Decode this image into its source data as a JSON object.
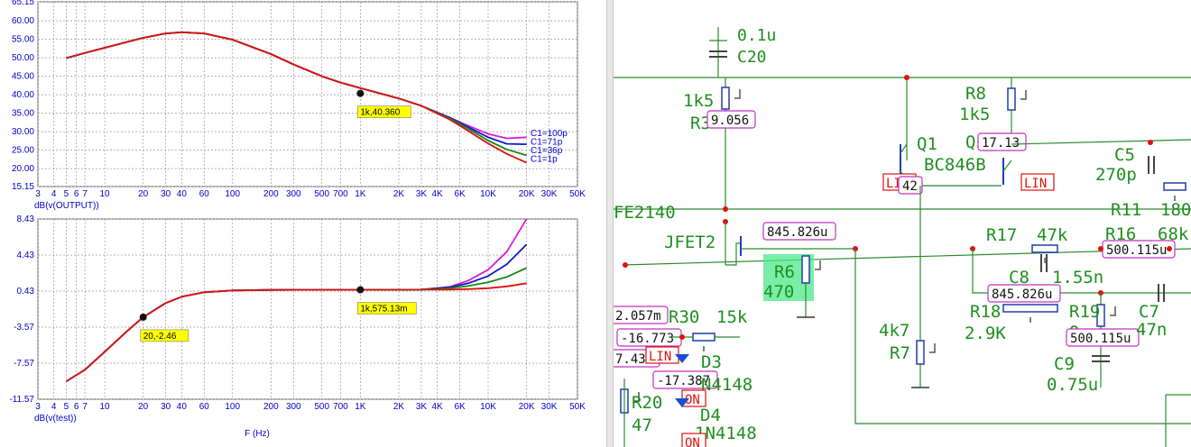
{
  "colors": {
    "axis_text": "#0000cc",
    "grid": "#9a9a9a",
    "series_c1_100p": "#d81ed8",
    "series_c1_71p": "#1414c8",
    "series_c1_36p": "#138a13",
    "series_c1_1p": "#dd1111",
    "cursor_label_bg": "#ffff00",
    "wire": "#2a8a2a",
    "part_text": "#1f8f1f",
    "component": "#1e3faa",
    "node": "#dd1111",
    "voltage_box_border": "#c030c0",
    "lin_tag": "#dd1111",
    "selection": "#4ce88a"
  },
  "chart_data": [
    {
      "type": "line",
      "xlabel": "",
      "ylabel": "dB(v(OUTPUT))",
      "xscale": "log",
      "xlim": [
        3,
        50000
      ],
      "ylim": [
        15.15,
        65.15
      ],
      "x_ticks": [
        3,
        4,
        5,
        6,
        7,
        10,
        20,
        30,
        40,
        60,
        100,
        200,
        300,
        500,
        700,
        1000,
        2000,
        3000,
        4000,
        6000,
        10000,
        20000,
        30000,
        50000
      ],
      "x_tick_labels": [
        "3",
        "4",
        "5",
        "6",
        "7",
        "10",
        "20",
        "30",
        "40",
        "60",
        "100",
        "200",
        "300",
        "500",
        "700",
        "1K",
        "2K",
        "3K",
        "4K",
        "6K",
        "10K",
        "20K",
        "30K",
        "50K"
      ],
      "y_ticks": [
        15.15,
        20.0,
        25.0,
        30.0,
        35.0,
        40.0,
        45.0,
        50.0,
        55.0,
        60.0,
        65.15
      ],
      "y_tick_labels": [
        "15.15",
        "20.00",
        "25.00",
        "30.00",
        "35.00",
        "40.00",
        "45.00",
        "50.00",
        "55.00",
        "60.00",
        "65.15"
      ],
      "grid": true,
      "legend": [
        "C1=100p",
        "C1=71p",
        "C1=36p",
        "C1=1p"
      ],
      "legend_placement": "right",
      "x": [
        5,
        7,
        10,
        15,
        20,
        30,
        40,
        60,
        100,
        200,
        300,
        500,
        700,
        1000,
        2000,
        3000,
        5000,
        7000,
        10000,
        14000,
        20000
      ],
      "series": [
        {
          "name": "C1=100p",
          "values": [
            49.9,
            51.3,
            52.7,
            54.3,
            55.4,
            56.6,
            56.9,
            56.6,
            54.9,
            51.0,
            48.2,
            45.0,
            43.3,
            41.8,
            39.0,
            37.0,
            33.8,
            31.6,
            29.4,
            28.2,
            28.5
          ]
        },
        {
          "name": "C1=71p",
          "values": [
            49.9,
            51.3,
            52.7,
            54.3,
            55.4,
            56.6,
            56.9,
            56.6,
            54.9,
            51.0,
            48.2,
            45.0,
            43.3,
            41.8,
            39.0,
            37.0,
            33.8,
            31.2,
            28.5,
            26.7,
            26.6
          ]
        },
        {
          "name": "C1=36p",
          "values": [
            49.9,
            51.3,
            52.7,
            54.3,
            55.4,
            56.6,
            56.9,
            56.6,
            54.9,
            51.0,
            48.2,
            45.0,
            43.3,
            41.8,
            39.0,
            37.0,
            33.6,
            30.8,
            27.6,
            25.2,
            23.6
          ]
        },
        {
          "name": "C1=1p",
          "values": [
            49.9,
            51.3,
            52.7,
            54.3,
            55.4,
            56.6,
            56.9,
            56.6,
            54.9,
            51.0,
            48.2,
            45.0,
            43.3,
            41.8,
            39.0,
            37.0,
            33.3,
            30.2,
            26.8,
            24.0,
            21.6
          ]
        }
      ],
      "cursors": [
        {
          "x": 1000,
          "y": 40.36,
          "label": "1k,40.360"
        }
      ]
    },
    {
      "type": "line",
      "xlabel": "F (Hz)",
      "ylabel": "dB(v(test))",
      "xscale": "log",
      "xlim": [
        3,
        50000
      ],
      "ylim": [
        -11.57,
        8.43
      ],
      "x_ticks": [
        3,
        4,
        5,
        6,
        7,
        10,
        20,
        30,
        40,
        60,
        100,
        200,
        300,
        500,
        700,
        1000,
        2000,
        3000,
        4000,
        6000,
        10000,
        20000,
        30000,
        50000
      ],
      "x_tick_labels": [
        "3",
        "4",
        "5",
        "6",
        "7",
        "10",
        "20",
        "30",
        "40",
        "60",
        "100",
        "200",
        "300",
        "500",
        "700",
        "1K",
        "2K",
        "3K",
        "4K",
        "6K",
        "10K",
        "20K",
        "30K",
        "50K"
      ],
      "y_ticks": [
        -11.57,
        -7.57,
        -3.57,
        0.43,
        4.43,
        8.43
      ],
      "y_tick_labels": [
        "-11.57",
        "-7.57",
        "-3.57",
        "0.43",
        "4.43",
        "8.43"
      ],
      "grid": true,
      "x": [
        5,
        7,
        10,
        15,
        20,
        30,
        40,
        60,
        100,
        200,
        300,
        500,
        700,
        1000,
        2000,
        3000,
        5000,
        7000,
        10000,
        14000,
        20000
      ],
      "series": [
        {
          "name": "C1=100p",
          "values": [
            -9.6,
            -8.3,
            -6.3,
            -4.0,
            -2.46,
            -0.9,
            -0.2,
            0.3,
            0.5,
            0.56,
            0.57,
            0.575,
            0.575,
            0.575,
            0.58,
            0.6,
            0.9,
            1.6,
            2.8,
            4.8,
            8.43
          ]
        },
        {
          "name": "C1=71p",
          "values": [
            -9.6,
            -8.3,
            -6.3,
            -4.0,
            -2.46,
            -0.9,
            -0.2,
            0.3,
            0.5,
            0.56,
            0.57,
            0.575,
            0.575,
            0.575,
            0.58,
            0.6,
            0.85,
            1.3,
            2.1,
            3.4,
            5.6
          ]
        },
        {
          "name": "C1=36p",
          "values": [
            -9.6,
            -8.3,
            -6.3,
            -4.0,
            -2.46,
            -0.9,
            -0.2,
            0.3,
            0.5,
            0.56,
            0.57,
            0.575,
            0.575,
            0.575,
            0.58,
            0.6,
            0.75,
            1.0,
            1.4,
            2.0,
            3.0
          ]
        },
        {
          "name": "C1=1p",
          "values": [
            -9.6,
            -8.3,
            -6.3,
            -4.0,
            -2.46,
            -0.9,
            -0.2,
            0.3,
            0.5,
            0.56,
            0.57,
            0.575,
            0.575,
            0.575,
            0.58,
            0.59,
            0.6,
            0.65,
            0.75,
            0.95,
            1.3
          ]
        }
      ],
      "cursors": [
        {
          "x": 20,
          "y": -2.46,
          "label": "20,-2.46"
        },
        {
          "x": 1000,
          "y": 0.575,
          "label": "1k,575.13m"
        }
      ]
    }
  ],
  "schematic": {
    "parts": {
      "c20": {
        "value": "0.1u",
        "ref": "C20"
      },
      "r3": {
        "value": "1k5",
        "ref": "R3"
      },
      "r8": {
        "ref": "R8",
        "value": "1k5"
      },
      "q1": {
        "ref": "Q1",
        "model": "BC846B"
      },
      "q2": {
        "ref": "Q"
      },
      "c5": {
        "ref": "C5",
        "value": "270p"
      },
      "jfet": {
        "model": "FE2140",
        "ref": "JFET2"
      },
      "r11": {
        "ref": "R11",
        "value": "180"
      },
      "r16": {
        "ref": "R16",
        "value": "68k"
      },
      "r17": {
        "ref": "R17",
        "value": "47k"
      },
      "r6": {
        "ref": "R6",
        "value": "470"
      },
      "c8": {
        "ref": "C8",
        "value": "1.55n"
      },
      "r18": {
        "ref": "R18",
        "value": "2.9K"
      },
      "r19": {
        "ref": "R19",
        "value": "9"
      },
      "c7": {
        "ref": "C7",
        "value": "47n"
      },
      "r7": {
        "value": "4k7",
        "ref": "R7"
      },
      "c9": {
        "ref": "C9",
        "value": "0.75u"
      },
      "r30": {
        "ref": "R30",
        "value": "15k"
      },
      "d3": {
        "ref": "D3",
        "model": "N4148"
      },
      "d4": {
        "ref": "D4",
        "model": "1N4148"
      },
      "r20": {
        "ref": "R20",
        "value": "47"
      }
    },
    "readouts": {
      "r3_v": "9.056",
      "q2_v": "17.13",
      "q1_v": "42",
      "jfet_v": "845.826u",
      "r16_v": "500.115u",
      "c8_v": "845.826u",
      "r19_v": "500.115u",
      "left1": "2.057m",
      "left2": "-16.773",
      "left3": "7.437",
      "d3_v": "-17.387"
    },
    "tags": {
      "lin": "LIN",
      "on": "ON"
    }
  }
}
